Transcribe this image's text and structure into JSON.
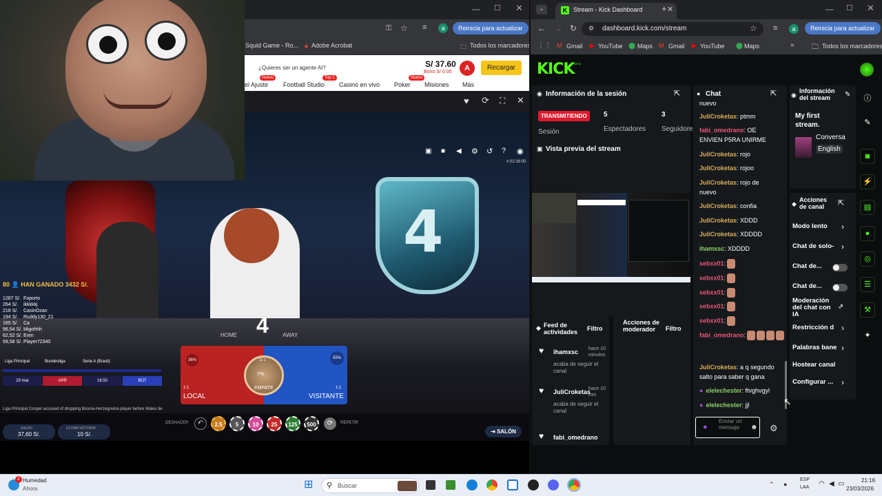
{
  "left_browser": {
    "bookmarks": [
      "Squid Game - Ro...",
      "Adobe Acrobat",
      "Todos los marcadores"
    ],
    "update_label": "Reinicia para actualizar",
    "avatar_letter": "a"
  },
  "casino": {
    "question": "¿Quieres ser un agente AI?",
    "balance": "S/ 37.60",
    "bono": "Bono S/ 0.00",
    "avatar_letter": "A",
    "recharge": "Recargar",
    "nav": [
      "el Ajuste",
      "Football Studio",
      "Casino en vivo",
      "Poker",
      "Misiones",
      "Más"
    ],
    "badges": {
      "nuevo1": "Nuevo",
      "top": "Top 1",
      "nuevo2": "Nuevo"
    },
    "won_text": "80 👤 HAN GANADO 3432 S/.",
    "winners": [
      {
        "amt": "1287 S/.",
        "name": "Foporto"
      },
      {
        "amt": "264 S/.",
        "name": "ikkkkkj"
      },
      {
        "amt": "218 S/.",
        "name": "CasinOzan"
      },
      {
        "amt": "194 S/.",
        "name": "Ruddy130_21"
      },
      {
        "amt": "165 S/.",
        "name": "Ca"
      },
      {
        "amt": "96,54 S/.",
        "name": "Migohhh"
      },
      {
        "amt": "62,52 S/.",
        "name": "Eren"
      },
      {
        "amt": "59,58 S/.",
        "name": "Player72340"
      }
    ],
    "leagues": [
      "Liga Principal",
      "Bundesliga",
      "Serie A (Brasil)"
    ],
    "tabs": [
      "29 mar",
      "APR",
      "16:50",
      "BOT"
    ],
    "ticker": "Liga Principal   Cooper accused of dropping Bosnia-Herzegovina player before Wales tie",
    "card_number": "4",
    "home": "HOME",
    "away": "AWAY",
    "timer": "# 02:16:00",
    "local_ratio": "1:1",
    "local_pct": "36%",
    "local_label": "LOCAL",
    "visit_ratio": "1:1",
    "visit_pct": "55%",
    "visit_label": "VISITANTE",
    "draw_pct": "7%",
    "draw_ratio": "11:1",
    "draw_label": "EMPATE",
    "undo": "DESHACER",
    "repeat": "REPETIR",
    "chips": [
      "2.5",
      "5",
      "10",
      "25",
      "125",
      "500"
    ],
    "saldo_label": "SALDO",
    "saldo_value": "37,60 S/.",
    "last_label": "ÚLTIMA VICTORIA",
    "last_value": "10 S/.",
    "salon": "SALÓN"
  },
  "kick": {
    "tab_title": "Stream - Kick Dashboard",
    "url": "dashboard.kick.com/stream",
    "update_label": "Reinicia para actualizar",
    "avatar_letter": "a",
    "bookmarks": [
      "Gmail",
      "YouTube",
      "Maps",
      "Gmail",
      "YouTube",
      "Maps",
      "Todos los marcadores"
    ],
    "logo": "KICK",
    "logo_sup": "BETA",
    "session_title": "Información de la sesión",
    "live_badge": "TRANSMITIENDO",
    "session_label": "Sesión",
    "viewers_count": "5",
    "viewers_label": "Espectadores",
    "followers_count": "3",
    "followers_label": "Seguidores",
    "preview_title": "Vista previa del stream",
    "chat_title": "Chat",
    "chat": [
      {
        "user": "",
        "text": "nuevo",
        "color": ""
      },
      {
        "user": "JuliCroketas",
        "text": ": ptmm",
        "color": "y"
      },
      {
        "user": "fabi_omedrano",
        "text": ": OE",
        "color": "p"
      },
      {
        "user": "",
        "text": "ENVIEN P5RA UNIRME",
        "color": ""
      },
      {
        "user": "JuliCroketas",
        "text": ": rojo",
        "color": "y"
      },
      {
        "user": "JuliCroketas",
        "text": ": rojoo",
        "color": "y"
      },
      {
        "user": "JuliCroketas",
        "text": ": rojo de",
        "color": "y"
      },
      {
        "user": "",
        "text": "nuevo",
        "color": ""
      },
      {
        "user": "JuliCroketas",
        "text": ": confia",
        "color": "y"
      },
      {
        "user": "JuliCroketas",
        "text": ": XDDD",
        "color": "y"
      },
      {
        "user": "JuliCroketas",
        "text": ": XDDDD",
        "color": "y"
      },
      {
        "user": "ihamxsc",
        "text": ": XDDDD",
        "color": "gr"
      },
      {
        "user": "sebxx01",
        "text": ":",
        "color": "p"
      },
      {
        "user": "sebxx01",
        "text": ":",
        "color": "p"
      },
      {
        "user": "sebxx01",
        "text": ":",
        "color": "p"
      },
      {
        "user": "sebxx01",
        "text": ":",
        "color": "p"
      },
      {
        "user": "sebxx01",
        "text": ":",
        "color": "p"
      },
      {
        "user": "fabi_omedrano",
        "text": ":",
        "color": "p"
      },
      {
        "user": "JuliCroketas",
        "text": ": a q segundo",
        "color": "y"
      },
      {
        "user": "",
        "text": "salto para saber q gana",
        "color": ""
      },
      {
        "user": "elelechester",
        "text": ": ftvghvgyl",
        "color": "gr"
      },
      {
        "user": "elelechester",
        "text": ": jjl",
        "color": "gr"
      }
    ],
    "chat_placeholder": "Enviar un mensaje",
    "info_title": "Información del stream",
    "stream_name": "My first stream.",
    "category": "Conversa",
    "language": "English",
    "actions_title": "Acciones de canal",
    "actions": [
      "Modo lento",
      "Chat de solo-",
      "Chat de...",
      "Chat de...",
      "Moderación del chat con IA",
      "Restricción d",
      "Palabras bane",
      "Hostear canal",
      "Configurar ..."
    ],
    "feed_title": "Feed de actividades",
    "feed_filter": "Filtro",
    "feed": [
      {
        "user": "ihamxsc",
        "time": "hace 10 minutos",
        "desc": "acaba de seguir el canal"
      },
      {
        "user": "JuliCroketas",
        "time": "hace 10 min",
        "desc": "acaba de seguir el canal"
      },
      {
        "user": "fabi_omedrano",
        "time": "",
        "desc": ""
      }
    ],
    "mod_title": "Acciones de moderador",
    "mod_filter": "Filtro"
  },
  "taskbar": {
    "weather_label": "Humedad",
    "weather_sub": "Ahora",
    "badge": "2",
    "search": "Buscar",
    "lang": "ESP",
    "lang_sub": "LAA",
    "time": "21:16",
    "date": "23/03/2026"
  }
}
